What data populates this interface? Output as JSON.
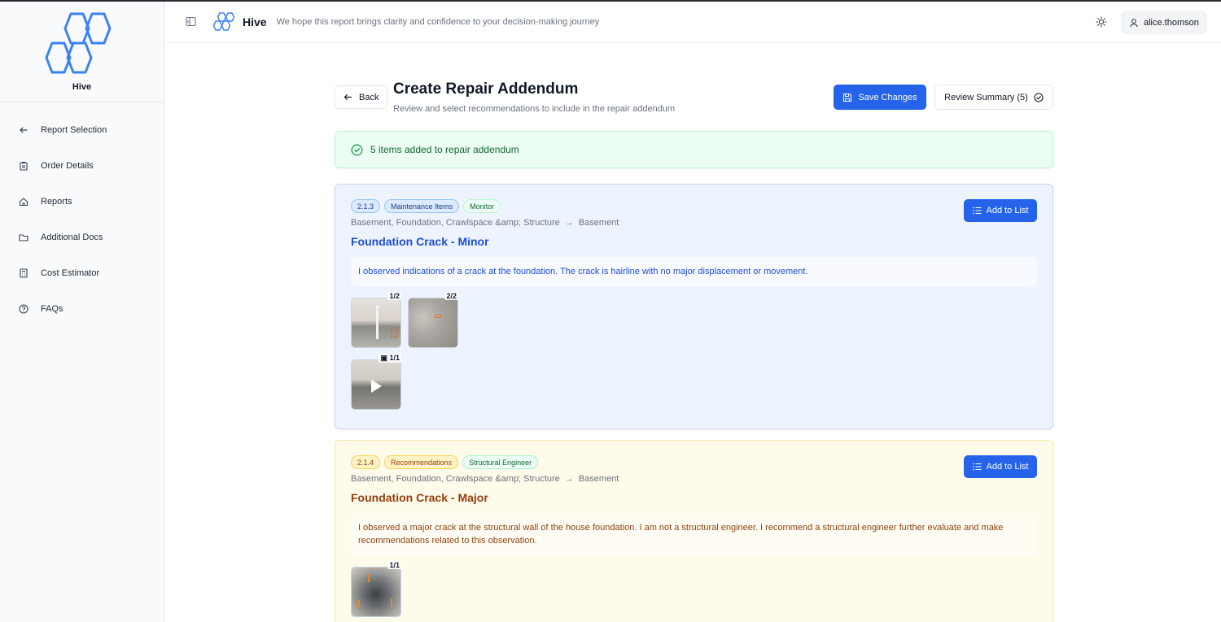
{
  "app": {
    "name": "Hive",
    "tagline": "We hope this report brings clarity and confidence to your decision-making journey"
  },
  "user": {
    "name": "alice.thomson"
  },
  "sidebar": {
    "items": [
      {
        "label": "Report Selection",
        "icon": "arrow-left-icon"
      },
      {
        "label": "Order Details",
        "icon": "clipboard-icon"
      },
      {
        "label": "Reports",
        "icon": "home-icon"
      },
      {
        "label": "Additional Docs",
        "icon": "folder-icon"
      },
      {
        "label": "Cost Estimator",
        "icon": "calculator-icon"
      },
      {
        "label": "FAQs",
        "icon": "help-circle-icon"
      }
    ]
  },
  "page": {
    "back_label": "Back",
    "title": "Create Repair Addendum",
    "subtitle": "Review and select recommendations to include in the repair addendum",
    "save_label": "Save Changes",
    "review_label": "Review Summary (5)"
  },
  "banner": {
    "text": "5 items added to repair addendum"
  },
  "colors": {
    "accent": "#2563eb",
    "success": "#166534"
  },
  "items": [
    {
      "number": "2.1.3",
      "category": "Maintenance Items",
      "status": "Monitor",
      "path": "Basement, Foundation, Crawlspace &amp; Structure",
      "path_arrow": "→",
      "location": "Basement",
      "title": "Foundation Crack - Minor",
      "description": "I observed indications of a crack at the foundation. The crack is hairline with no major displacement or movement.",
      "add_label": "Add to List",
      "photos": [
        "1/2",
        "2/2"
      ],
      "video_count": "1/1"
    },
    {
      "number": "2.1.4",
      "category": "Recommendations",
      "status": "Structural Engineer",
      "path": "Basement, Foundation, Crawlspace &amp; Structure",
      "path_arrow": "→",
      "location": "Basement",
      "title": "Foundation Crack - Major",
      "description": "I observed a major crack at the structural wall of the house foundation. I am not a structural engineer. I recommend a structural engineer further evaluate and make recommendations related to this observation.",
      "add_label": "Add to List",
      "photos": [
        "1/1"
      ]
    }
  ]
}
